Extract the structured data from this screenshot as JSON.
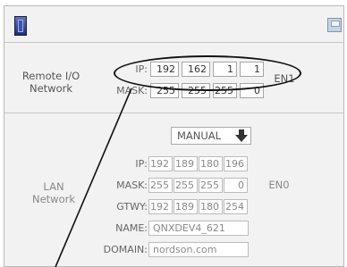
{
  "icons": {
    "app": "device-config-icon",
    "save": "save-icon"
  },
  "remote": {
    "title": "Remote I/O\nNetwork",
    "ip_label": "IP:",
    "ip": [
      "192",
      "162",
      "1",
      "1"
    ],
    "mask_label": "MASK:",
    "mask": [
      "255",
      "255",
      "255",
      "0"
    ],
    "port": "EN1"
  },
  "lan": {
    "mode": "MANUAL",
    "title": "LAN\nNetwork",
    "ip_label": "IP:",
    "ip": [
      "192",
      "189",
      "180",
      "196"
    ],
    "mask_label": "MASK:",
    "mask": [
      "255",
      "255",
      "255",
      "0"
    ],
    "gateway_label": "GTWY:",
    "gateway": [
      "192",
      "189",
      "180",
      "254"
    ],
    "name_label": "NAME:",
    "name": "QNXDEV4_621",
    "domain_label": "DOMAIN:",
    "domain": "nordson.com",
    "port": "EN0"
  }
}
